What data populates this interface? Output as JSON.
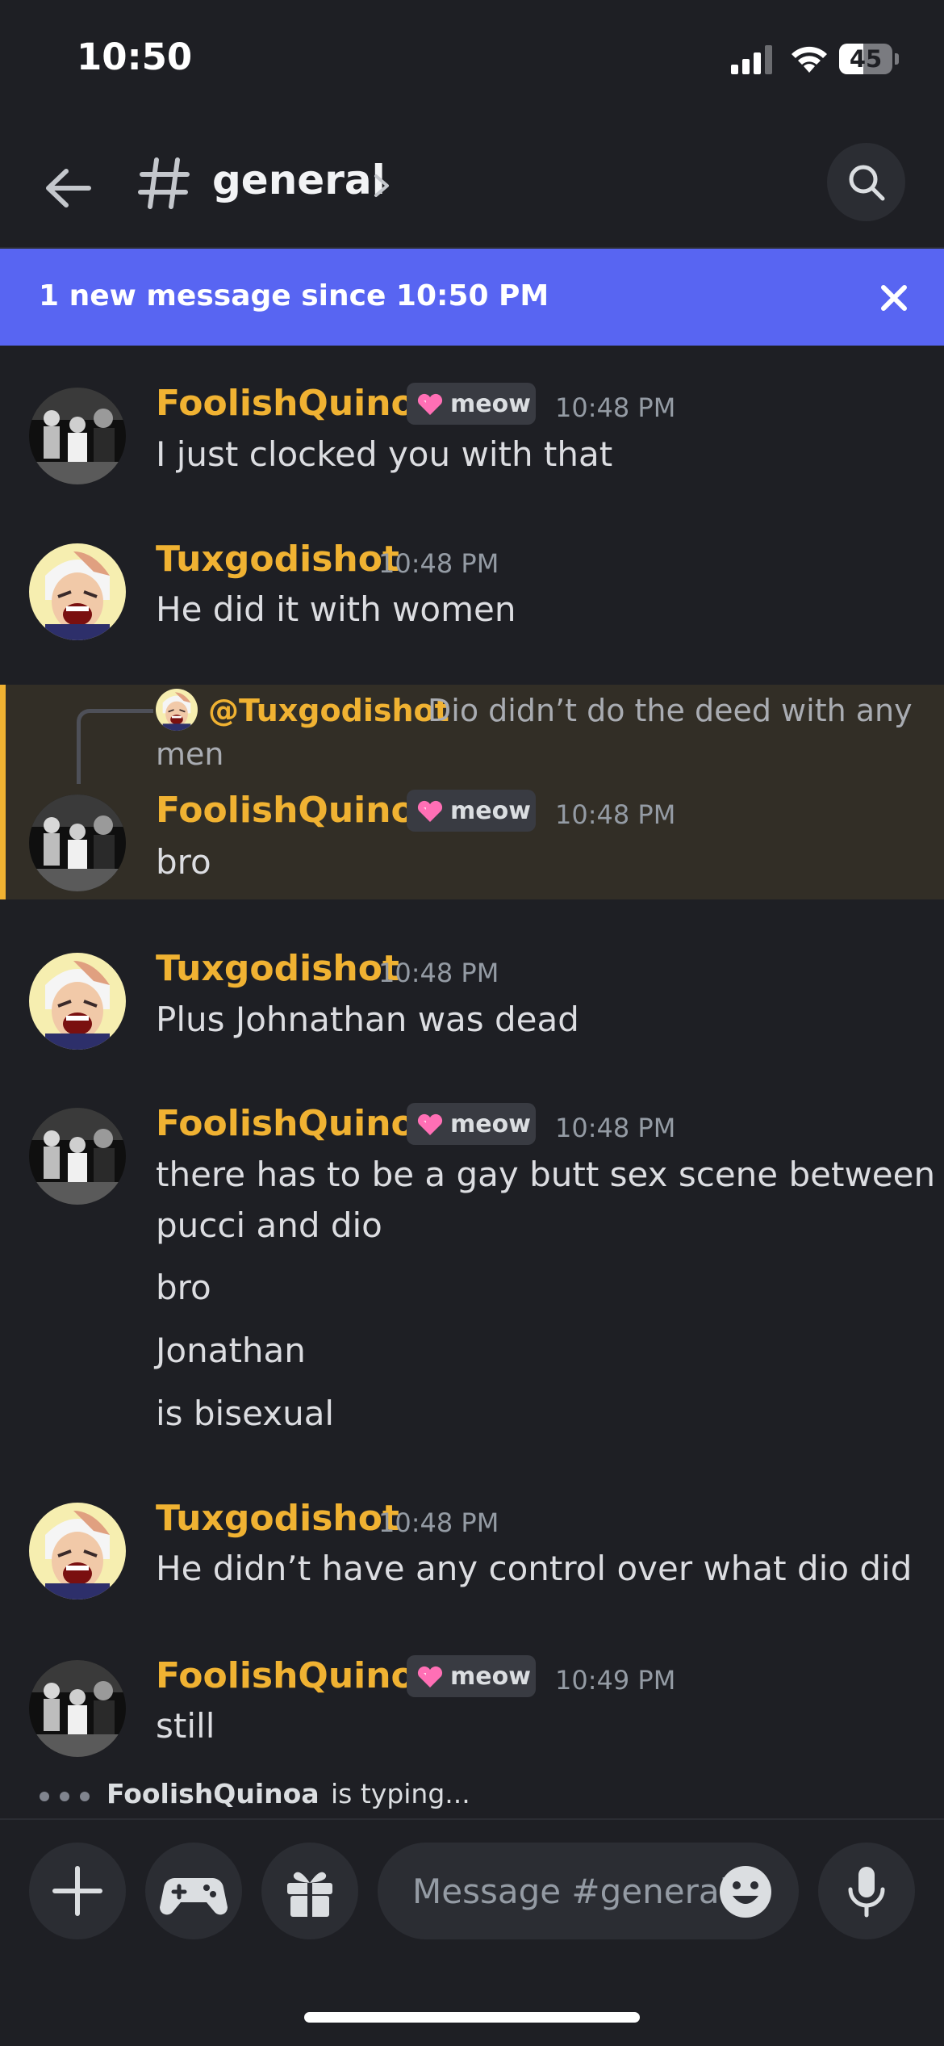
{
  "status_bar": {
    "time": "10:50",
    "battery": "45",
    "battery_level": 0.45
  },
  "header": {
    "channel_name": "general"
  },
  "banner": {
    "text": "1 new message since 10:50 PM"
  },
  "badge_label": "meow",
  "messages": [
    {
      "username": "FoolishQuinoa",
      "has_badge": true,
      "timestamp": "10:48 PM",
      "lines": [
        "I just clocked you with that"
      ]
    },
    {
      "username": "Tuxgodishot",
      "has_badge": false,
      "timestamp": "10:48 PM",
      "lines": [
        "He did it with women"
      ]
    },
    {
      "username": "FoolishQuinoa",
      "has_badge": true,
      "timestamp": "10:48 PM",
      "lines": [
        "bro"
      ],
      "reply": {
        "mention": "@Tuxgodishot",
        "text_line1": "Dio didn’t do the deed with any",
        "text_line2": "men"
      }
    },
    {
      "username": "Tuxgodishot",
      "has_badge": false,
      "timestamp": "10:48 PM",
      "lines": [
        "Plus Johnathan was dead"
      ]
    },
    {
      "username": "FoolishQuinoa",
      "has_badge": true,
      "timestamp": "10:48 PM",
      "lines": [
        "there has to be a gay butt sex scene between",
        "pucci and dio",
        "bro",
        "Jonathan",
        "is bisexual"
      ]
    },
    {
      "username": "Tuxgodishot",
      "has_badge": false,
      "timestamp": "10:48 PM",
      "lines": [
        "He didn’t have any control over what dio did"
      ]
    },
    {
      "username": "FoolishQuinoa",
      "has_badge": true,
      "timestamp": "10:49 PM",
      "lines": [
        "still"
      ]
    }
  ],
  "typing": {
    "user": "FoolishQuinoa",
    "rest": "is typing..."
  },
  "composer": {
    "placeholder": "Message #general"
  },
  "icons": [
    "back-arrow-icon",
    "hash-icon",
    "chevron-right-icon",
    "search-icon",
    "close-icon",
    "heart-icon",
    "plus-icon",
    "gamepad-icon",
    "gift-icon",
    "emoji-icon",
    "microphone-icon"
  ],
  "colors": {
    "accent": "#5865f2",
    "username": "#f0b232",
    "background": "#1e1f24",
    "highlight": "#322e26"
  }
}
